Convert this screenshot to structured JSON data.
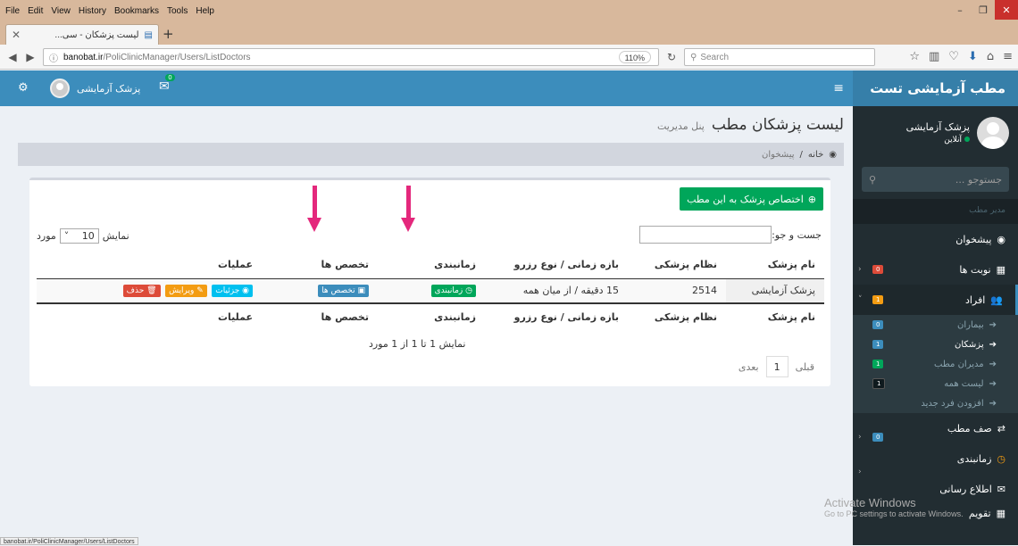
{
  "browser": {
    "menu": [
      "File",
      "Edit",
      "View",
      "History",
      "Bookmarks",
      "Tools",
      "Help"
    ],
    "tab_title": "لیست پزشکان - سی...",
    "url_host": "banobat.ir",
    "url_path": "/PoliClinicManager/Users/ListDoctors",
    "zoom": "110%",
    "search_placeholder": "Search",
    "status_url": "banobat.ir/PoliClinicManager/Users/ListDoctors"
  },
  "topbar": {
    "username": "پزشک آزمایشی",
    "mail_count": "0"
  },
  "sidebar": {
    "logo": "مطب آزمایشی تست",
    "user_name": "پزشک آزمایشی",
    "user_status": "آنلاین",
    "search_placeholder": "جستوجو ...",
    "header": "مدیر مطب",
    "items": [
      {
        "label": "پیشخوان"
      },
      {
        "label": "نوبت ها",
        "badge": "0"
      },
      {
        "label": "افراد",
        "badge": "1"
      }
    ],
    "subitems": [
      {
        "label": "بیماران",
        "badge": "0"
      },
      {
        "label": "پزشکان",
        "badge": "1"
      },
      {
        "label": "مدیران مطب",
        "badge": "1"
      },
      {
        "label": "لیست همه"
      },
      {
        "label": "افزودن فرد جدید"
      }
    ],
    "items2": [
      {
        "label": "صف مطب",
        "badge": "0"
      },
      {
        "label": "زمانبندی"
      },
      {
        "label": "اطلاع رسانی"
      },
      {
        "label": "تقویم"
      }
    ]
  },
  "page": {
    "title": "لیست پزشکان مطب",
    "subtitle": "پنل مدیریت",
    "breadcrumb_home": "خانه",
    "breadcrumb_current": "پیشخوان",
    "add_button": "اختصاص پزشک به این مطب",
    "search_label": "جست و جو:",
    "show_label": "نمایش",
    "show_value": "10",
    "show_suffix": "مورد",
    "columns": [
      "نام پزشک",
      "نظام پزشکی",
      "بازه زمانی / نوع رزرو",
      "زمانبندی",
      "تخصص ها",
      "عملیات"
    ],
    "row": {
      "name": "پزشک آزمایشی",
      "code": "2514",
      "period": "15 دقیقه / از میان همه",
      "schedule_btn": "زمانبندی",
      "spec_btn": "تخصص ها",
      "details_btn": "جزئیات",
      "edit_btn": "ویرایش",
      "delete_btn": "حذف"
    },
    "info": "نمایش 1 تا 1 از 1 مورد",
    "pager_prev": "قبلی",
    "pager_page": "1",
    "pager_next": "بعدی"
  },
  "watermark": {
    "line1": "Activate Windows",
    "line2": "Go to PC settings to activate Windows."
  }
}
